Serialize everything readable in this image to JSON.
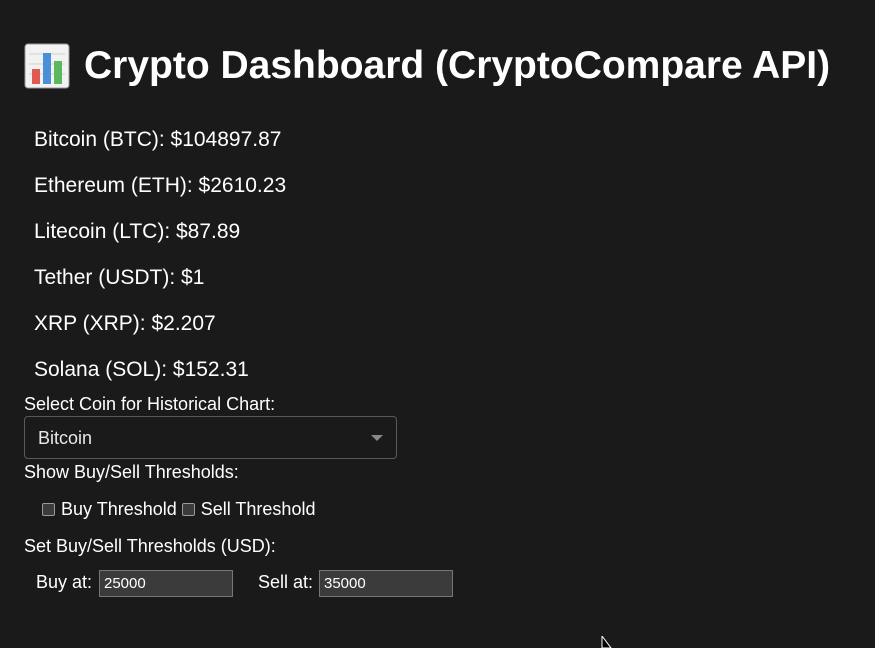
{
  "header": {
    "icon": "bar-chart-icon",
    "title": "Crypto Dashboard (CryptoCompare API)"
  },
  "prices": [
    {
      "text": "Bitcoin (BTC): $104897.87"
    },
    {
      "text": "Ethereum (ETH): $2610.23"
    },
    {
      "text": "Litecoin (LTC): $87.89"
    },
    {
      "text": "Tether (USDT): $1"
    },
    {
      "text": "XRP (XRP): $2.207"
    },
    {
      "text": "Solana (SOL): $152.31"
    }
  ],
  "coin_select": {
    "label": "Select Coin for Historical Chart:",
    "selected": "Bitcoin"
  },
  "thresholds_toggle": {
    "label": "Show Buy/Sell Thresholds:",
    "buy_label": "Buy Threshold",
    "sell_label": "Sell Threshold",
    "buy_checked": false,
    "sell_checked": false
  },
  "thresholds": {
    "label": "Set Buy/Sell Thresholds (USD):",
    "buy_label": "Buy at:",
    "buy_value": "25000",
    "sell_label": "Sell at:",
    "sell_value": "35000"
  },
  "colors": {
    "background": "#1a1a1a",
    "text": "#ffffff",
    "icon_bar_red": "#e05a4f",
    "icon_bar_blue": "#4a90d9",
    "icon_bar_green": "#5cb85c"
  }
}
